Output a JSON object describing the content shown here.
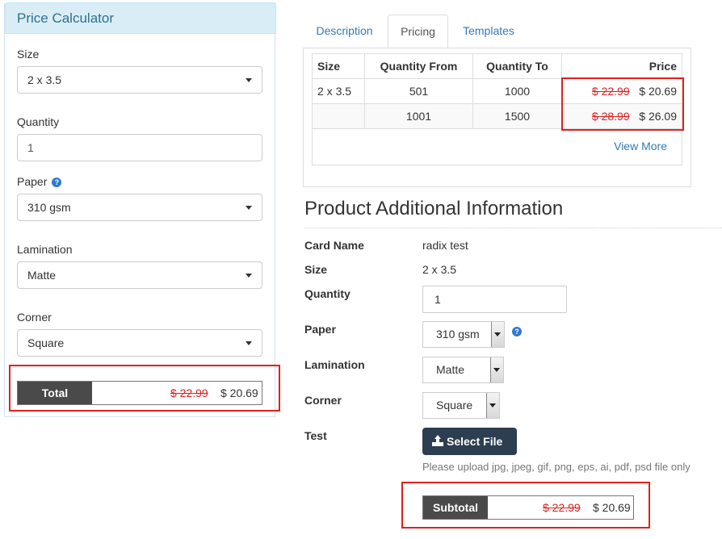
{
  "calculator": {
    "title": "Price Calculator",
    "size_label": "Size",
    "size_value": "2 x 3.5",
    "quantity_label": "Quantity",
    "quantity_value": "1",
    "paper_label": "Paper",
    "paper_value": "310 gsm",
    "lamination_label": "Lamination",
    "lamination_value": "Matte",
    "corner_label": "Corner",
    "corner_value": "Square",
    "total_label": "Total",
    "total_old": "$ 22.99",
    "total_new": "$ 20.69"
  },
  "tabs": [
    "Description",
    "Pricing",
    "Templates"
  ],
  "pricing_table": {
    "headers": [
      "Size",
      "Quantity From",
      "Quantity To",
      "Price"
    ],
    "rows": [
      {
        "size": "2 x 3.5",
        "from": "501",
        "to": "1000",
        "old": "$ 22.99",
        "new": "$ 20.69"
      },
      {
        "size": "",
        "from": "1001",
        "to": "1500",
        "old": "$ 28.99",
        "new": "$ 26.09"
      }
    ],
    "view_more": "View More"
  },
  "additional": {
    "title": "Product Additional Information",
    "card_name_label": "Card Name",
    "card_name_value": "radix test",
    "size_label": "Size",
    "size_value": "2 x 3.5",
    "quantity_label": "Quantity",
    "quantity_value": "1",
    "paper_label": "Paper",
    "paper_value": "310 gsm",
    "lamination_label": "Lamination",
    "lamination_value": "Matte",
    "corner_label": "Corner",
    "corner_value": "Square",
    "test_label": "Test",
    "select_file": "Select File",
    "upload_help": "Please upload jpg, jpeg, gif, png, eps, ai, pdf, psd file only",
    "subtotal_label": "Subtotal",
    "subtotal_old": "$ 22.99",
    "subtotal_new": "$ 20.69"
  },
  "colors": {
    "accent": "#337ab7",
    "highlight": "#e02020",
    "dark": "#4a4a4a",
    "button": "#2c3e50",
    "header_bg": "#d9edf7"
  },
  "icons": {
    "help": "question-circle-icon",
    "upload": "upload-icon",
    "caret": "caret-down-icon"
  }
}
